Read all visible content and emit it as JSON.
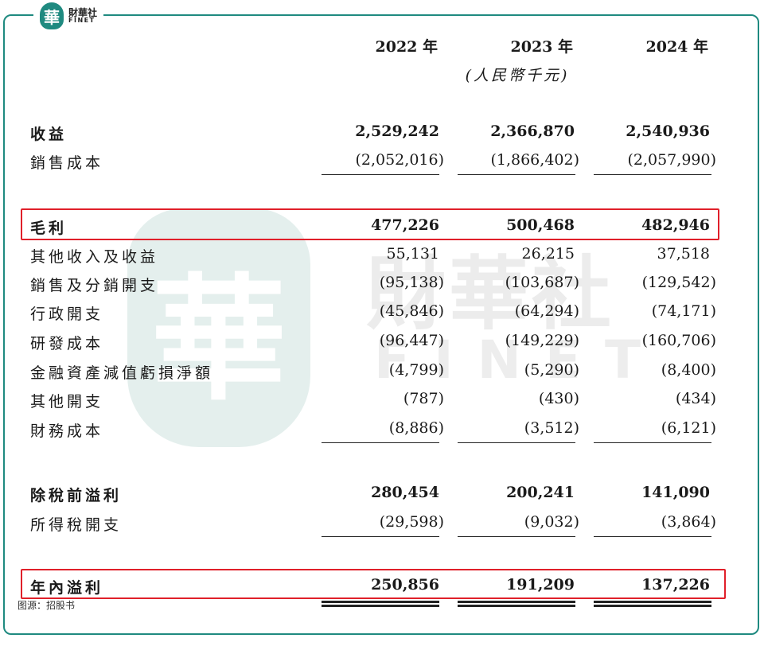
{
  "brand": {
    "cn": "財華社",
    "en": "FINET",
    "mark": "華",
    "watermark_cn": "財華社",
    "watermark_en": "FINET"
  },
  "columns": [
    "2022 年",
    "2023 年",
    "2024 年"
  ],
  "unit": "(人民幣千元)",
  "rows": [
    {
      "label": "收益",
      "values": [
        "2,529,242",
        "2,366,870",
        "2,540,936"
      ]
    },
    {
      "label": "銷售成本",
      "values": [
        "(2,052,016)",
        "(1,866,402)",
        "(2,057,990)"
      ]
    },
    {
      "label": "毛利",
      "values": [
        "477,226",
        "500,468",
        "482,946"
      ]
    },
    {
      "label": "其他收入及收益",
      "values": [
        "55,131",
        "26,215",
        "37,518"
      ]
    },
    {
      "label": "銷售及分銷開支",
      "values": [
        "(95,138)",
        "(103,687)",
        "(129,542)"
      ]
    },
    {
      "label": "行政開支",
      "values": [
        "(45,846)",
        "(64,294)",
        "(74,171)"
      ]
    },
    {
      "label": "研發成本",
      "values": [
        "(96,447)",
        "(149,229)",
        "(160,706)"
      ]
    },
    {
      "label": "金融資產減值虧損淨額",
      "values": [
        "(4,799)",
        "(5,290)",
        "(8,400)"
      ]
    },
    {
      "label": "其他開支",
      "values": [
        "(787)",
        "(430)",
        "(434)"
      ]
    },
    {
      "label": "財務成本",
      "values": [
        "(8,886)",
        "(3,512)",
        "(6,121)"
      ]
    },
    {
      "label": "除稅前溢利",
      "values": [
        "280,454",
        "200,241",
        "141,090"
      ]
    },
    {
      "label": "所得稅開支",
      "values": [
        "(29,598)",
        "(9,032)",
        "(3,864)"
      ]
    },
    {
      "label": "年內溢利",
      "values": [
        "250,856",
        "191,209",
        "137,226"
      ]
    }
  ],
  "source": "图源：招股书",
  "highlight_color": "#e0202a",
  "accent_color": "#1f8a80"
}
